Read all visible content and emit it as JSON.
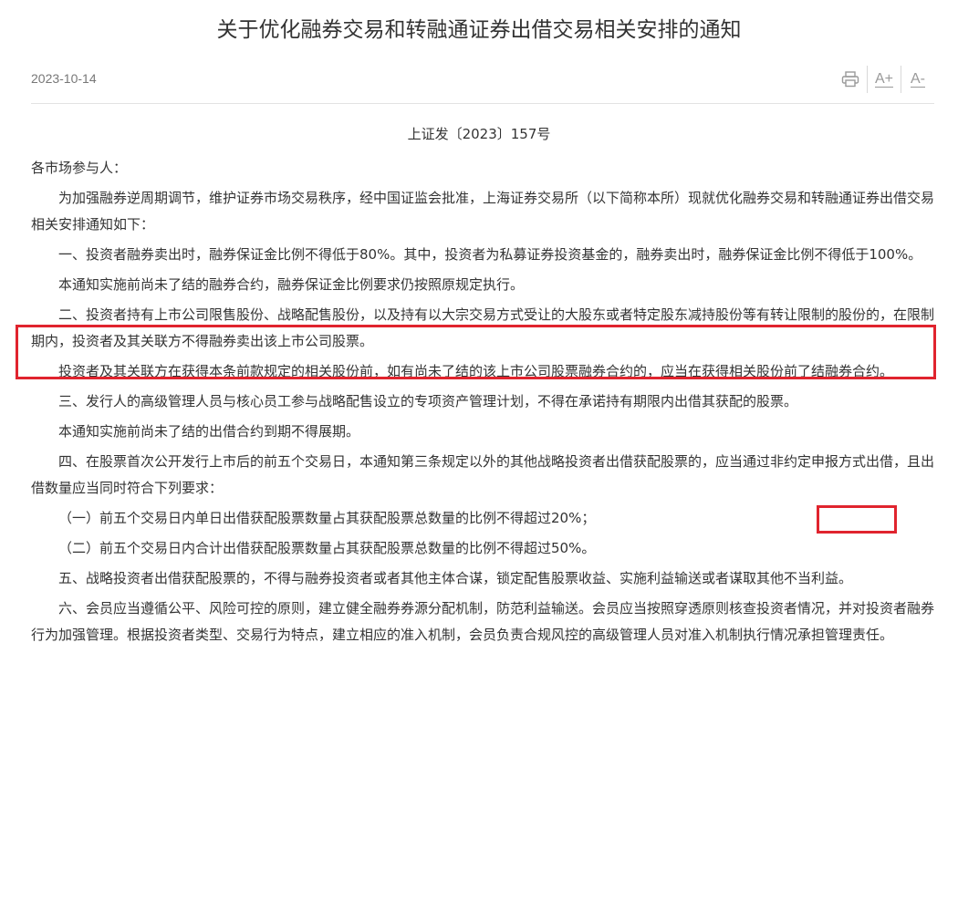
{
  "header": {
    "title": "关于优化融券交易和转融通证券出借交易相关安排的通知",
    "date": "2023-10-14",
    "tools": {
      "print_icon": "print-icon",
      "font_increase": "A+",
      "font_decrease": "A-"
    }
  },
  "document": {
    "number": "上证发〔2023〕157号",
    "addressee": "各市场参与人：",
    "paragraphs": [
      "为加强融券逆周期调节，维护证券市场交易秩序，经中国证监会批准，上海证券交易所（以下简称本所）现就优化融券交易和转融通证券出借交易相关安排通知如下：",
      "一、投资者融券卖出时，融券保证金比例不得低于80%。其中，投资者为私募证券投资基金的，融券卖出时，融券保证金比例不得低于100%。",
      "本通知实施前尚未了结的融券合约，融券保证金比例要求仍按照原规定执行。",
      "二、投资者持有上市公司限售股份、战略配售股份，以及持有以大宗交易方式受让的大股东或者特定股东减持股份等有转让限制的股份的，在限制期内，投资者及其关联方不得融券卖出该上市公司股票。",
      "投资者及其关联方在获得本条前款规定的相关股份前，如有尚未了结的该上市公司股票融券合约的，应当在获得相关股份前了结融券合约。",
      "三、发行人的高级管理人员与核心员工参与战略配售设立的专项资产管理计划，不得在承诺持有期限内出借其获配的股票。",
      "本通知实施前尚未了结的出借合约到期不得展期。",
      "四、在股票首次公开发行上市后的前五个交易日，本通知第三条规定以外的其他战略投资者出借获配股票的，应当通过非约定申报方式出借，且出借数量应当同时符合下列要求：",
      "（一）前五个交易日内单日出借获配股票数量占其获配股票总数量的比例不得超过20%；",
      "（二）前五个交易日内合计出借获配股票数量占其获配股票总数量的比例不得超过50%。",
      "五、战略投资者出借获配股票的，不得与融券投资者或者其他主体合谋，锁定配售股票收益、实施利益输送或者谋取其他不当利益。",
      "六、会员应当遵循公平、风险可控的原则，建立健全融券券源分配机制，防范利益输送。会员应当按照穿透原则核查投资者情况，并对投资者融券行为加强管理。根据投资者类型、交易行为特点，建立相应的准入机制，会员负责合规风控的高级管理人员对准入机制执行情况承担管理责任。"
    ]
  },
  "annotations": {
    "box_color": "#e0242e"
  }
}
